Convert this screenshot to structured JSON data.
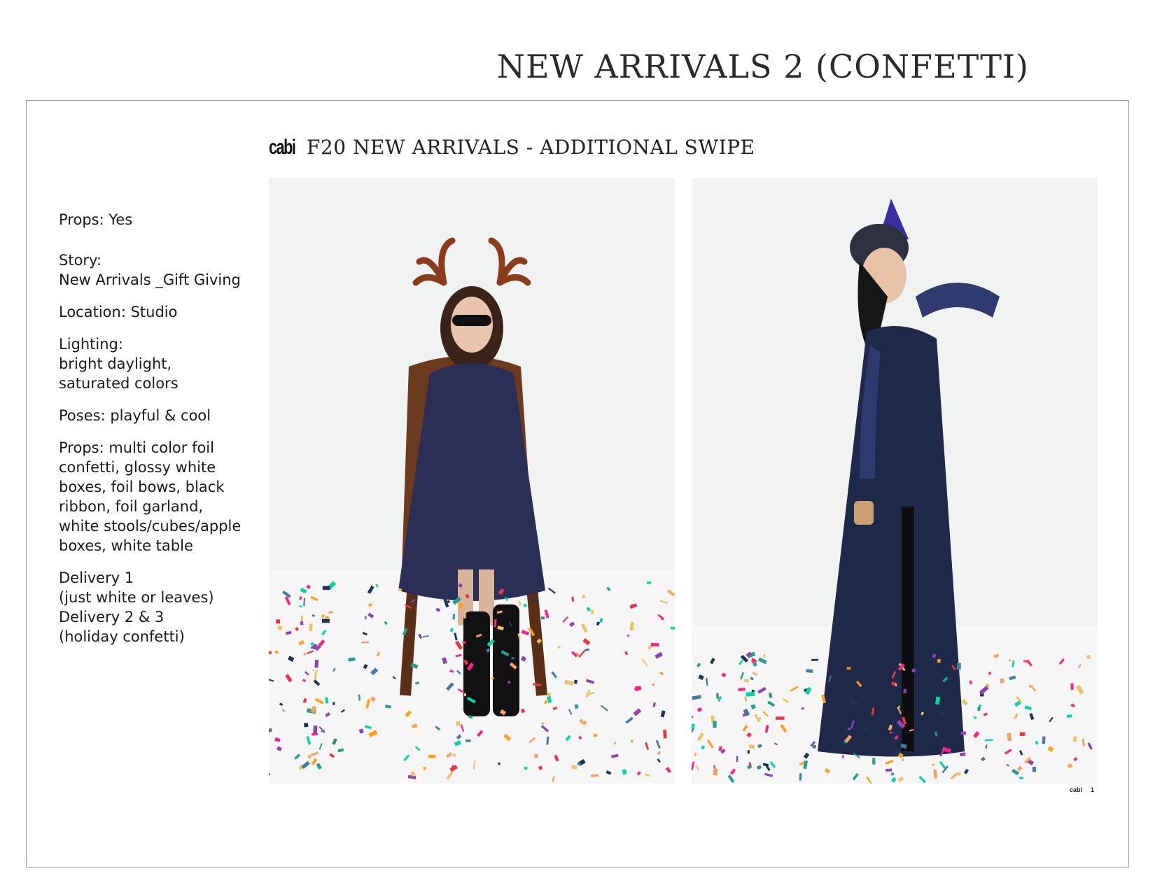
{
  "page": {
    "title": "NEW ARRIVALS 2 (CONFETTI)"
  },
  "slide": {
    "brand": "cabi",
    "title": "F20 NEW ARRIVALS - ADDITIONAL SWIPE"
  },
  "notes": [
    "Props: Yes",
    "Story:\nNew Arrivals _Gift Giving",
    "Location: Studio",
    "Lighting:\nbright daylight,\nsaturated colors",
    "Poses: playful & cool",
    "Props: multi color foil\nconfetti, glossy white\nboxes, foil bows, black\nribbon, foil garland,\nwhite stools/cubes/apple\nboxes, white table",
    "Delivery 1\n(just white or leaves)\nDelivery 2 & 3\n(holiday confetti)"
  ],
  "footer": {
    "brand": "cabi",
    "page_number": "1"
  },
  "colors": {
    "confetti": [
      "#e63946",
      "#f4a261",
      "#2a9d8f",
      "#457b9d",
      "#e9c46a",
      "#8e44ad",
      "#1d3557",
      "#f72585",
      "#06d6a0",
      "#ff9f1c"
    ],
    "dress": "#2b2f55",
    "gown": "#1f2a4a"
  }
}
